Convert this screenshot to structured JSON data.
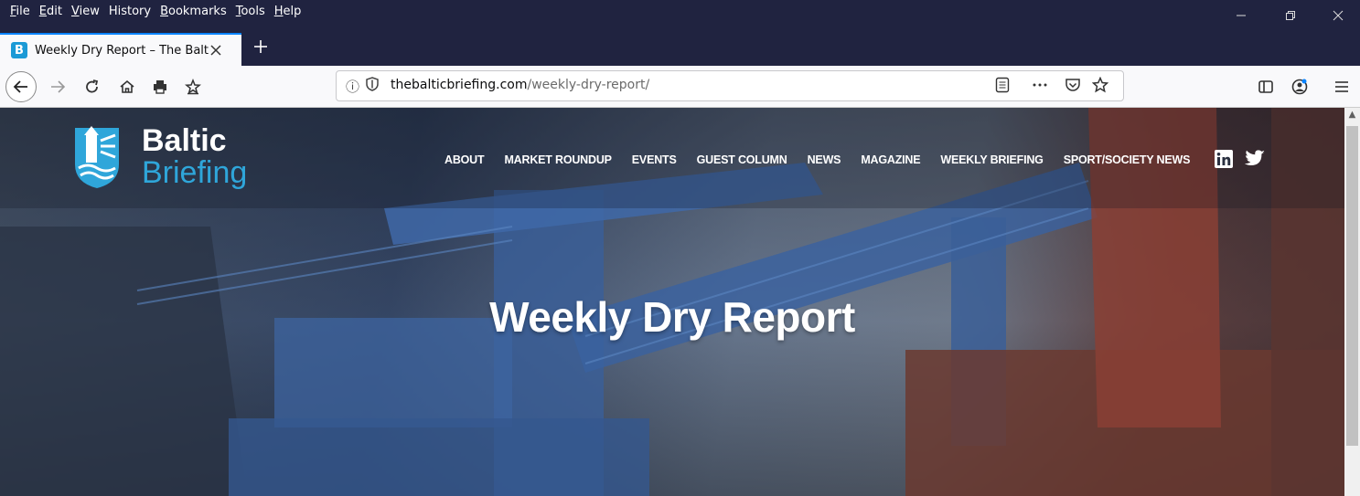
{
  "menu": [
    {
      "label": "File",
      "key": "F",
      "rest": "ile"
    },
    {
      "label": "Edit",
      "key": "E",
      "rest": "dit"
    },
    {
      "label": "View",
      "key": "V",
      "rest": "iew"
    },
    {
      "label": "History",
      "key": "",
      "rest": "History"
    },
    {
      "label": "Bookmarks",
      "key": "B",
      "rest": "ookmarks"
    },
    {
      "label": "Tools",
      "key": "T",
      "rest": "ools"
    },
    {
      "label": "Help",
      "key": "H",
      "rest": "elp"
    }
  ],
  "tab": {
    "title": "Weekly Dry Report – The Baltic",
    "favicon": "B"
  },
  "url": {
    "domain": "thebalticbriefing.com",
    "path": "/weekly-dry-report/"
  },
  "site": {
    "logo_line1": "Baltic",
    "logo_line2": "Briefing",
    "nav": [
      "ABOUT",
      "MARKET ROUNDUP",
      "EVENTS",
      "GUEST COLUMN",
      "NEWS",
      "MAGAZINE",
      "WEEKLY BRIEFING",
      "SPORT/SOCIETY NEWS"
    ],
    "social": [
      "linkedin-icon",
      "twitter-icon"
    ],
    "hero_title": "Weekly Dry Report"
  },
  "colors": {
    "titlebar": "#202340",
    "brand_blue": "#2fa6da",
    "tab_accent": "#0a84ff"
  }
}
